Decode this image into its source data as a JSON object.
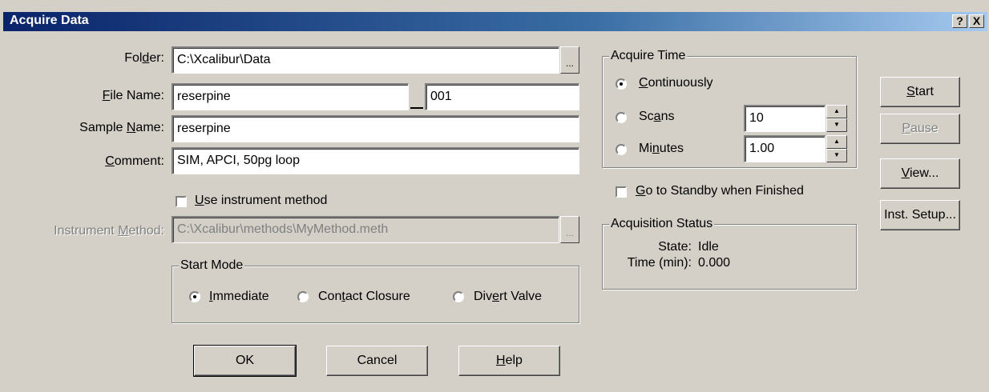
{
  "window": {
    "title": "Acquire Data",
    "help_glyph": "?",
    "close_glyph": "X"
  },
  "form": {
    "folder": {
      "label_pre": "Fol",
      "label_ul": "d",
      "label_post": "er:",
      "value": "C:\\Xcalibur\\Data"
    },
    "file_name": {
      "label_pre": "",
      "label_ul": "F",
      "label_post": "ile Name:",
      "value": "reserpine",
      "suffix": "001"
    },
    "sample_name": {
      "label_pre": "Sample ",
      "label_ul": "N",
      "label_post": "ame:",
      "value": "reserpine"
    },
    "comment": {
      "label_pre": "",
      "label_ul": "C",
      "label_post": "omment:",
      "value": "SIM, APCI, 50pg loop"
    },
    "use_instrument_method": {
      "label_pre": "",
      "label_ul": "U",
      "label_post": "se instrument method",
      "checked": false
    },
    "instrument_method": {
      "label_pre": "Instrument ",
      "label_ul": "M",
      "label_post": "ethod:",
      "value": "C:\\Xcalibur\\methods\\MyMethod.meth",
      "disabled": true
    },
    "ellipsis": "..."
  },
  "start_mode": {
    "title": "Start Mode",
    "options": [
      {
        "pre": "",
        "ul": "I",
        "post": "mmediate",
        "checked": true
      },
      {
        "pre": "Con",
        "ul": "t",
        "post": "act Closure",
        "checked": false
      },
      {
        "pre": "Div",
        "ul": "e",
        "post": "rt Valve",
        "checked": false
      }
    ]
  },
  "acquire_time": {
    "title": "Acquire Time",
    "continuously": {
      "pre": "",
      "ul": "C",
      "post": "ontinuously",
      "checked": true
    },
    "scans": {
      "pre": "Sc",
      "ul": "a",
      "post": "ns",
      "checked": false,
      "value": "10"
    },
    "minutes": {
      "pre": "Mi",
      "ul": "n",
      "post": "utes",
      "checked": false,
      "value": "1.00"
    }
  },
  "standby": {
    "pre": "",
    "ul": "G",
    "post": "o to Standby when Finished",
    "checked": false
  },
  "status": {
    "title": "Acquisition Status",
    "state_label": "State:",
    "state_value": "Idle",
    "time_label": "Time (min):",
    "time_value": "0.000"
  },
  "side_buttons": {
    "start": {
      "pre": "",
      "ul": "S",
      "post": "tart"
    },
    "pause": {
      "pre": "",
      "ul": "P",
      "post": "ause",
      "disabled": true
    },
    "view": {
      "pre": "",
      "ul": "V",
      "post": "iew..."
    },
    "inst_setup": {
      "pre": "Inst. Setup...",
      "ul": "",
      "post": ""
    }
  },
  "bottom_buttons": {
    "ok": "OK",
    "cancel": "Cancel",
    "help": {
      "pre": "",
      "ul": "H",
      "post": "elp"
    }
  },
  "spin_glyphs": {
    "up": "▲",
    "down": "▼"
  }
}
